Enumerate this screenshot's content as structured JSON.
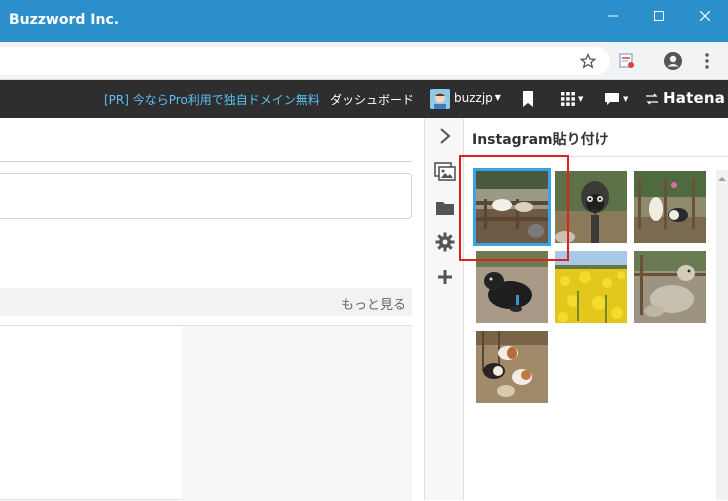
{
  "window": {
    "title": "Buzzword Inc.",
    "icons": [
      "minimize-icon",
      "maximize-icon",
      "close-icon"
    ]
  },
  "toolbar": {
    "icons": [
      "bookmark-star-icon",
      "extension-icon",
      "account-icon",
      "menu-dots-icon"
    ]
  },
  "hatena_header": {
    "promo_link": "[PR] 今ならPro利用で独自ドメイン無料",
    "dashboard_link": "ダッシュボード",
    "username": "buzzjp",
    "logo": "Hatena",
    "promo_color": "#5bc0f5",
    "background": "#2e2e2e"
  },
  "editor": {
    "more_link": "もっと見る"
  },
  "sidebar": {
    "icons": [
      "chevron-right-icon",
      "image-icon",
      "folder-icon",
      "gear-icon",
      "plus-icon"
    ]
  },
  "instagram_panel": {
    "title": "Instagram貼り付け",
    "photos": [
      {
        "subject": "goats on wooden fence",
        "selected": true
      },
      {
        "subject": "emu close-up",
        "selected": false
      },
      {
        "subject": "goats in pen",
        "selected": false
      },
      {
        "subject": "black lamb lying",
        "selected": false
      },
      {
        "subject": "yellow rapeseed field",
        "selected": false
      },
      {
        "subject": "sheep by fence",
        "selected": false
      },
      {
        "subject": "guinea pigs",
        "selected": false
      }
    ],
    "highlight_color": "#e02020",
    "selection_color": "#3aa3e3"
  }
}
